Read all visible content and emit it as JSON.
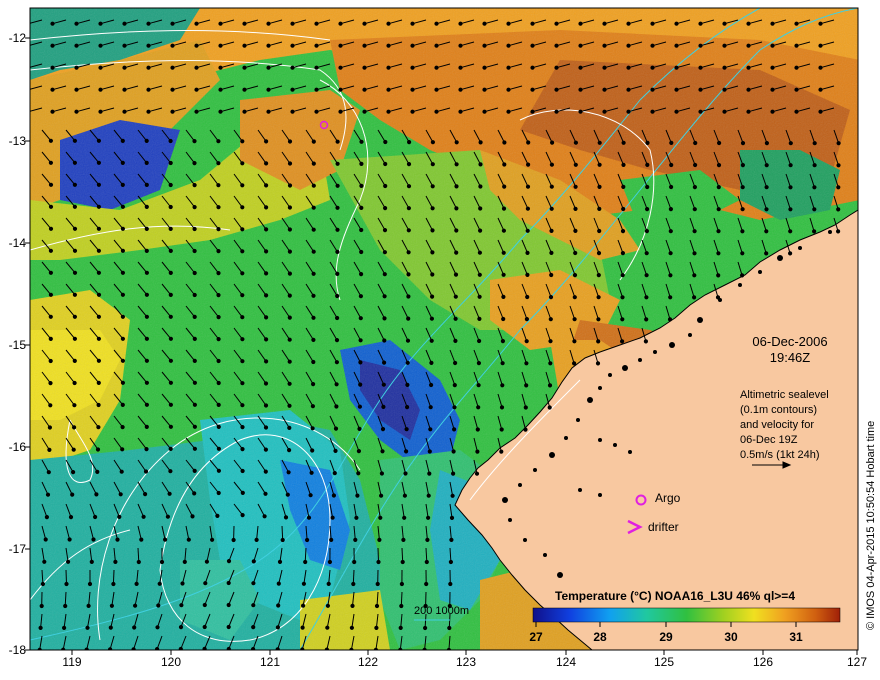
{
  "map": {
    "x_ticks": [
      "119",
      "120",
      "121",
      "122",
      "123",
      "124",
      "125",
      "126",
      "127"
    ],
    "y_ticks": [
      "-12",
      "-13",
      "-14",
      "-15",
      "-16",
      "-17",
      "-18"
    ]
  },
  "info": {
    "date": "06-Dec-2006",
    "time": "19:46Z",
    "alt_line1": "Altimetric sealevel",
    "alt_line2": "(0.1m contours)",
    "alt_line3": "and velocity for",
    "alt_line4": "06-Dec 19Z",
    "alt_line5": "0.5m/s (1kt 24h)"
  },
  "legend": {
    "argo_label": "Argo",
    "drifter_label": "drifter",
    "depth_label": "200  1000m",
    "colorbar_title": "Temperature (°C) NOAA16_L3U 46% ql>=4",
    "colorbar_ticks": [
      "27",
      "28",
      "29",
      "30",
      "31"
    ]
  },
  "credit": "© IMOS 04-Apr-2015 10:50:54 Hobart time",
  "colors": {
    "land": "#f8c8a0",
    "argo": "#e020e0",
    "drifter": "#e020e0",
    "contour": "#ffffff",
    "isobath": "#40d0e0"
  }
}
